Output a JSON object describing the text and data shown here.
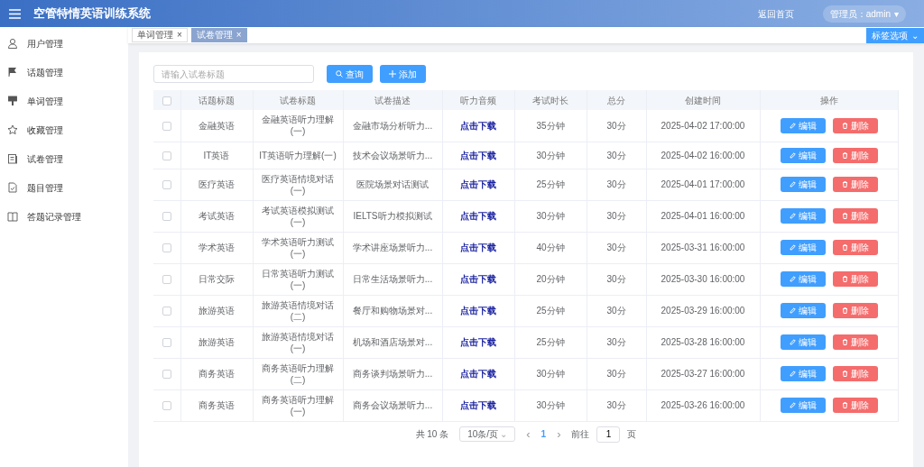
{
  "header": {
    "title": "空管特情英语训练系统",
    "home_link": "返回首页",
    "user": "管理员：admin",
    "user_caret": "▾"
  },
  "sidebar": {
    "items": [
      {
        "label": "用户管理"
      },
      {
        "label": "话题管理"
      },
      {
        "label": "单词管理"
      },
      {
        "label": "收藏管理"
      },
      {
        "label": "试卷管理"
      },
      {
        "label": "题目管理"
      },
      {
        "label": "答题记录管理"
      }
    ]
  },
  "tabs": [
    {
      "label": "单词管理",
      "close": "×",
      "selected": false
    },
    {
      "label": "试卷管理",
      "close": "×",
      "selected": true
    }
  ],
  "tab_options_button": {
    "label": "标签选项",
    "caret": "⌄"
  },
  "toolbar": {
    "search": {
      "placeholder": "请输入试卷标题"
    },
    "query_button": "查询",
    "add_button": "添加"
  },
  "table": {
    "header_checked": false,
    "columns": [
      "话题标题",
      "试卷标题",
      "试卷描述",
      "听力音频",
      "考试时长",
      "总分",
      "创建时间",
      "操作"
    ],
    "rows": [
      {
        "checked": false,
        "topic": "金融英语",
        "title": "金融英语听力理解(一)",
        "description": "金融市场分析听力...",
        "audio": "点击下载",
        "duration": "35分钟",
        "score": "30分",
        "created": "2025-04-02 17:00:00",
        "edit": "编辑",
        "delete": "删除"
      },
      {
        "checked": false,
        "topic": "IT英语",
        "title": "IT英语听力理解(一)",
        "description": "技术会议场景听力...",
        "audio": "点击下载",
        "duration": "30分钟",
        "score": "30分",
        "created": "2025-04-02 16:00:00",
        "edit": "编辑",
        "delete": "删除"
      },
      {
        "checked": false,
        "topic": "医疗英语",
        "title": "医疗英语情境对话(一)",
        "description": "医院场景对话测试",
        "audio": "点击下载",
        "duration": "25分钟",
        "score": "30分",
        "created": "2025-04-01 17:00:00",
        "edit": "编辑",
        "delete": "删除"
      },
      {
        "checked": false,
        "topic": "考试英语",
        "title": "考试英语模拟测试(一)",
        "description": "IELTS听力模拟测试",
        "audio": "点击下载",
        "duration": "30分钟",
        "score": "30分",
        "created": "2025-04-01 16:00:00",
        "edit": "编辑",
        "delete": "删除"
      },
      {
        "checked": false,
        "topic": "学术英语",
        "title": "学术英语听力测试(一)",
        "description": "学术讲座场景听力...",
        "audio": "点击下载",
        "duration": "40分钟",
        "score": "30分",
        "created": "2025-03-31 16:00:00",
        "edit": "编辑",
        "delete": "删除"
      },
      {
        "checked": false,
        "topic": "日常交际",
        "title": "日常英语听力测试(一)",
        "description": "日常生活场景听力...",
        "audio": "点击下载",
        "duration": "20分钟",
        "score": "30分",
        "created": "2025-03-30 16:00:00",
        "edit": "编辑",
        "delete": "删除"
      },
      {
        "checked": false,
        "topic": "旅游英语",
        "title": "旅游英语情境对话(二)",
        "description": "餐厅和购物场景对...",
        "audio": "点击下载",
        "duration": "25分钟",
        "score": "30分",
        "created": "2025-03-29 16:00:00",
        "edit": "编辑",
        "delete": "删除"
      },
      {
        "checked": false,
        "topic": "旅游英语",
        "title": "旅游英语情境对话(一)",
        "description": "机场和酒店场景对...",
        "audio": "点击下载",
        "duration": "25分钟",
        "score": "30分",
        "created": "2025-03-28 16:00:00",
        "edit": "编辑",
        "delete": "删除"
      },
      {
        "checked": false,
        "topic": "商务英语",
        "title": "商务英语听力理解(二)",
        "description": "商务谈判场景听力...",
        "audio": "点击下载",
        "duration": "30分钟",
        "score": "30分",
        "created": "2025-03-27 16:00:00",
        "edit": "编辑",
        "delete": "删除"
      },
      {
        "checked": false,
        "topic": "商务英语",
        "title": "商务英语听力理解(一)",
        "description": "商务会议场景听力...",
        "audio": "点击下载",
        "duration": "30分钟",
        "score": "30分",
        "created": "2025-03-26 16:00:00",
        "edit": "编辑",
        "delete": "删除"
      }
    ]
  },
  "pagination": {
    "total": "共 10 条",
    "page_size": "10条/页",
    "page_size_caret": "⌄",
    "prev": "‹",
    "pages": [
      {
        "label": "1",
        "selected": true
      }
    ],
    "next": "›",
    "goto_label": "前往",
    "goto_value": "1",
    "goto_suffix": "页"
  }
}
